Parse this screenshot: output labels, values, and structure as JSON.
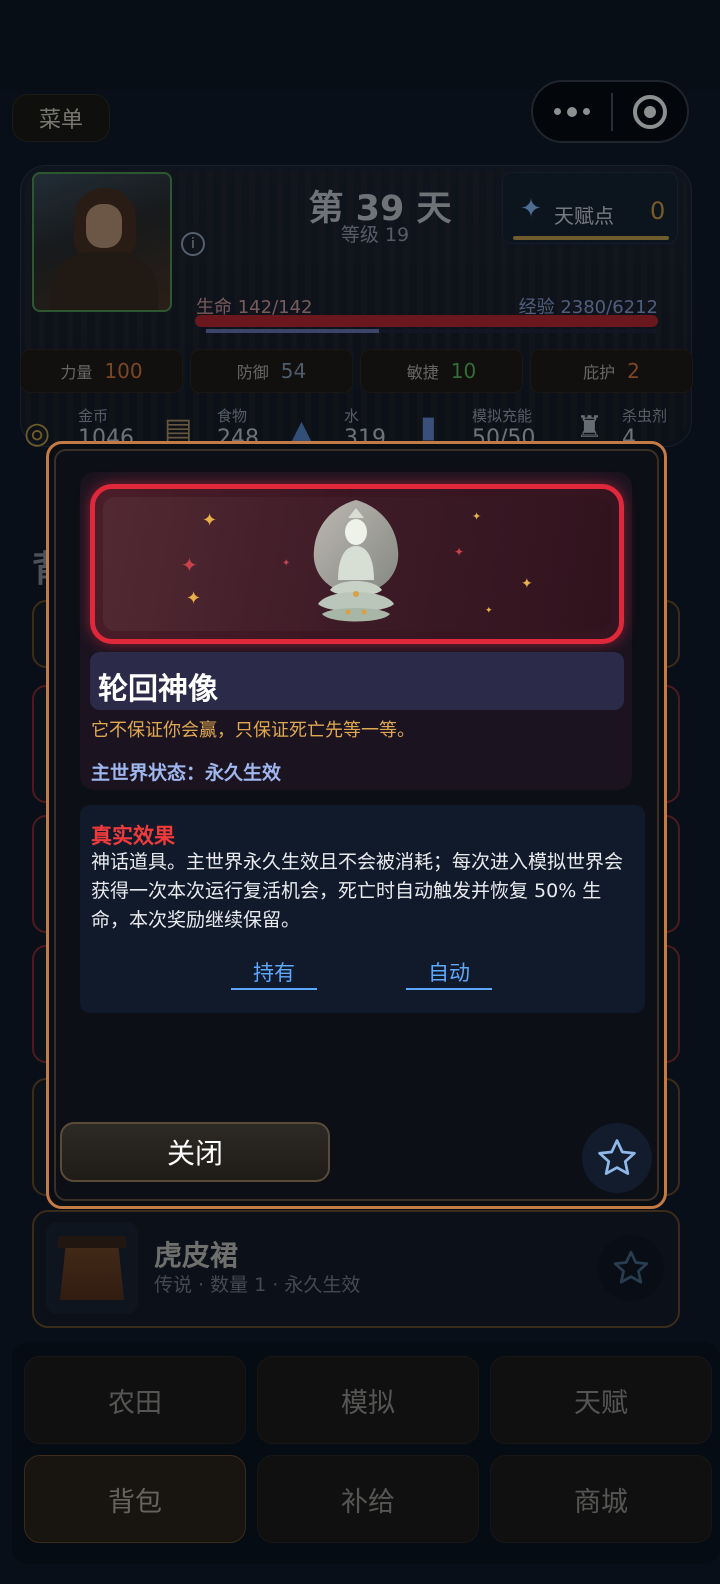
{
  "header": {
    "menu_label": "菜单"
  },
  "player": {
    "day_title": "第 39 天",
    "level_text": "等级 19",
    "talent_label": "天赋点",
    "talent_points": "0",
    "hp_text": "生命 142/142",
    "exp_text": "经验 2380/6212",
    "hp_fraction": 1.0,
    "exp_fraction": 0.383
  },
  "stats": [
    {
      "label": "力量",
      "value": "100",
      "color": "#e07a3a"
    },
    {
      "label": "防御",
      "value": "54",
      "color": "#8aa0b8"
    },
    {
      "label": "敏捷",
      "value": "10",
      "color": "#5dbf5d"
    },
    {
      "label": "庇护",
      "value": "2",
      "color": "#e07a3a"
    }
  ],
  "resources": [
    {
      "label": "金币",
      "value": "1046",
      "icon": "coins-icon"
    },
    {
      "label": "食物",
      "value": "248",
      "icon": "food-icon"
    },
    {
      "label": "水",
      "value": "319",
      "icon": "water-icon"
    },
    {
      "label": "模拟充能",
      "value": "50/50",
      "icon": "battery-icon"
    },
    {
      "label": "杀虫剂",
      "value": "4",
      "icon": "spray-icon"
    }
  ],
  "background_list": {
    "title": "背",
    "visible_item": {
      "name": "虎皮裙",
      "meta": "传说 · 数量 1 · 永久生效"
    }
  },
  "modal": {
    "item_name": "轮回神像",
    "quote": "它不保证你会赢，只保证死亡先等一等。",
    "world_status": "主世界状态：永久生效",
    "effect_title": "真实效果",
    "effect_text": "神话道具。主世界永久生效且不会被消耗；每次进入模拟世界会获得一次本次运行复活机会，死亡时自动触发并恢复 50% 生命，本次奖励继续保留。",
    "tags": [
      "持有",
      "自动"
    ],
    "close_label": "关闭"
  },
  "nav": {
    "items": [
      "农田",
      "模拟",
      "天赋",
      "背包",
      "补给",
      "商城"
    ],
    "active": "背包"
  },
  "colors": {
    "accent_orange": "#c47a44",
    "frame_red": "#e0283a",
    "link_blue": "#5ea8ff",
    "effect_red": "#ef3b3b"
  }
}
